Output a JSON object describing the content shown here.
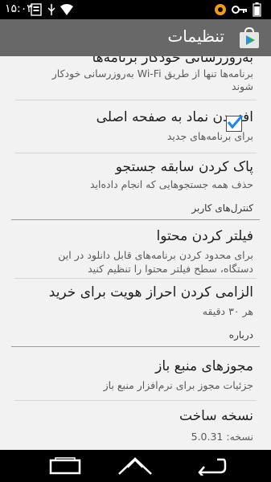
{
  "status_bar": {
    "time": "۱۵:۰۳"
  },
  "app_bar": {
    "title": "تنظیمات"
  },
  "settings": {
    "auto_update": {
      "title": "به‌روزرسانی خودکار برنامه‌ها",
      "summary_line1": "برنامه‌ها تنها از طریق Wi-Fi به‌روزرسانی خودکار",
      "summary_line2": "شوند"
    },
    "add_icon": {
      "title": "افزودن نماد به صفحه اصلی",
      "summary": "برای برنامه‌های جدید",
      "checked": true
    },
    "clear_history": {
      "title": "پاک کردن سابقه جستجو",
      "summary": "حذف همه جستجوهایی که انجام داده‌اید"
    },
    "user_controls_header": "کنترل‌های کاربر",
    "content_filter": {
      "title": "فیلتر کردن محتوا",
      "summary_line1": "برای محدود کردن برنامه‌های قابل دانلود در این",
      "summary_line2": "دستگاه، سطح فیلتر محتوا را تنظیم کنید"
    },
    "require_auth": {
      "title": "الزامی کردن احراز هویت برای خرید",
      "summary": "هر ۳۰ دقیقه"
    },
    "about_header": "درباره",
    "open_source": {
      "title": "مجوزهای منبع باز",
      "summary": "جزئیات مجوز برای نرم‌افزار منبع باز"
    },
    "build_version": {
      "title": "نسخه ساخت",
      "summary_label": "نسخه:",
      "version": "5.0.31"
    }
  },
  "icons": {
    "status_left": [
      "notification-icon",
      "usb-icon",
      "wifi-icon"
    ],
    "status_right": [
      "sync-icon",
      "vpn-key-icon",
      "battery-icon"
    ],
    "nav": [
      "back-icon",
      "home-icon",
      "recent-apps-icon"
    ]
  },
  "colors": {
    "app_bar": "#686868",
    "accent_checkbox": "#1e88e5",
    "status_bar": "#000000"
  }
}
